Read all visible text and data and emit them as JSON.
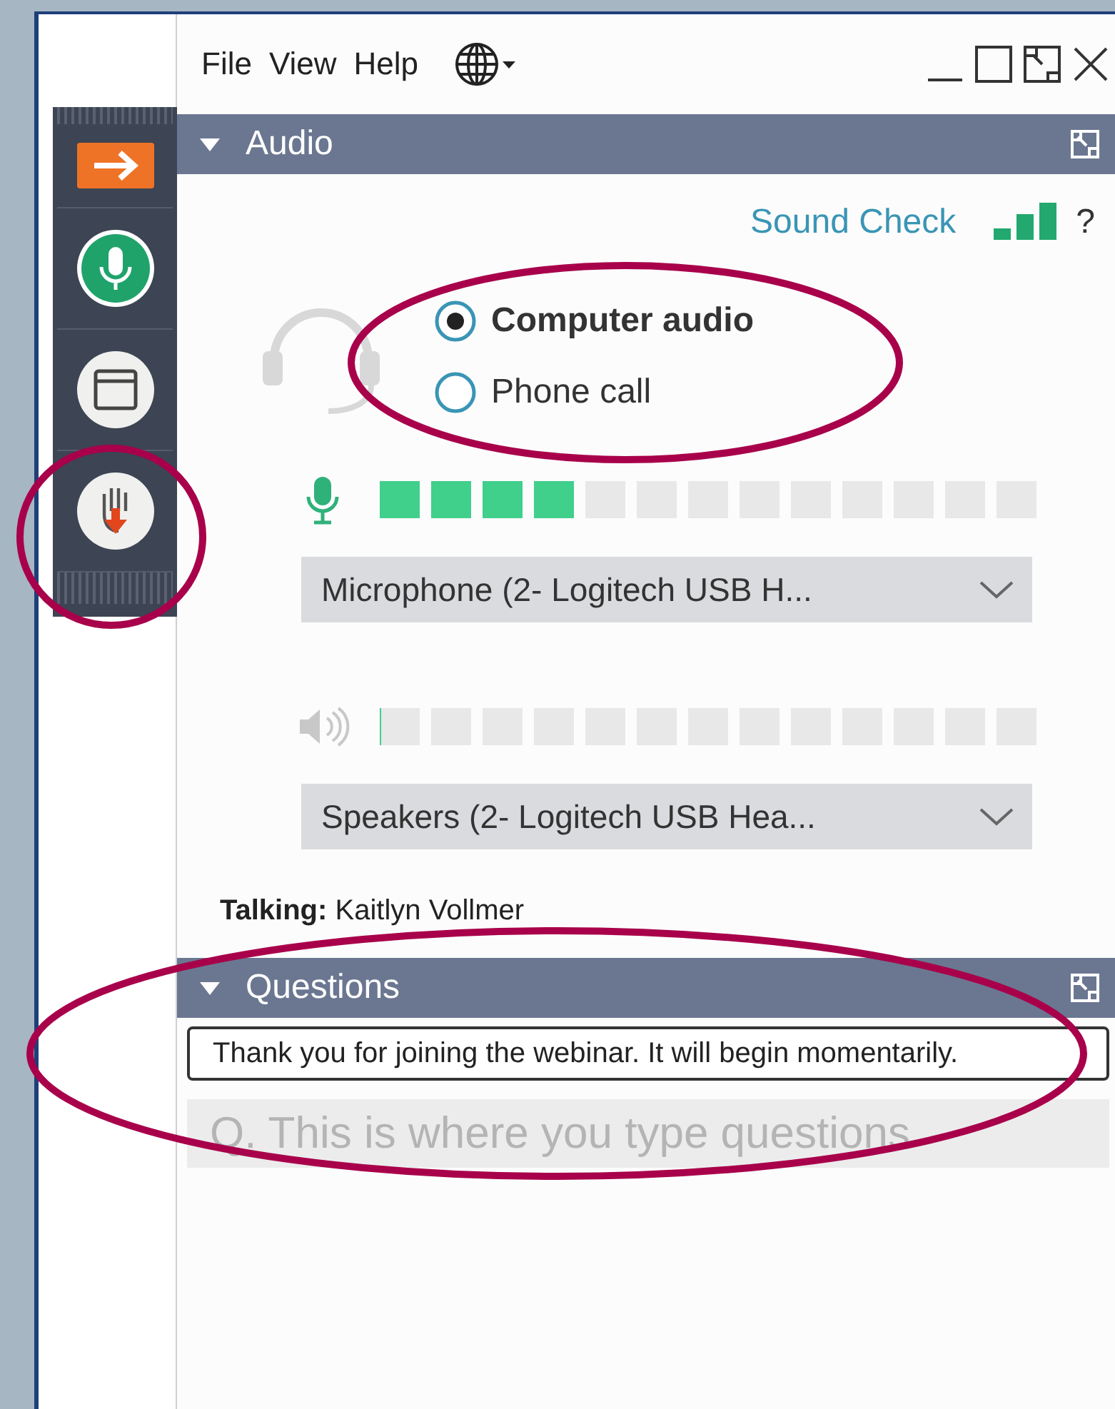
{
  "menu": [
    {
      "label": "File"
    },
    {
      "label": "View"
    },
    {
      "label": "Help"
    }
  ],
  "grab_tab": {
    "hand_circled": true
  },
  "audio": {
    "title": "Audio",
    "expanded": true,
    "sound_check": "Sound Check",
    "help": "?",
    "options_circled": true,
    "options": [
      {
        "label": "Computer audio",
        "selected": true
      },
      {
        "label": "Phone call",
        "selected": false
      }
    ],
    "microphone": {
      "level": 0.3077,
      "device": "Microphone (2- Logitech  USB H..."
    },
    "speakers": {
      "level": 0,
      "device": "Speakers (2- Logitech  USB Hea..."
    },
    "talking_label": "Talking:",
    "talking_name": "Kaitlyn Vollmer"
  },
  "questions": {
    "title": "Questions",
    "expanded": true,
    "circled": true,
    "message": "Thank you for joining the webinar. It will begin momentarily.",
    "input": {
      "placeholder": "Q. This is where you type questions"
    }
  }
}
